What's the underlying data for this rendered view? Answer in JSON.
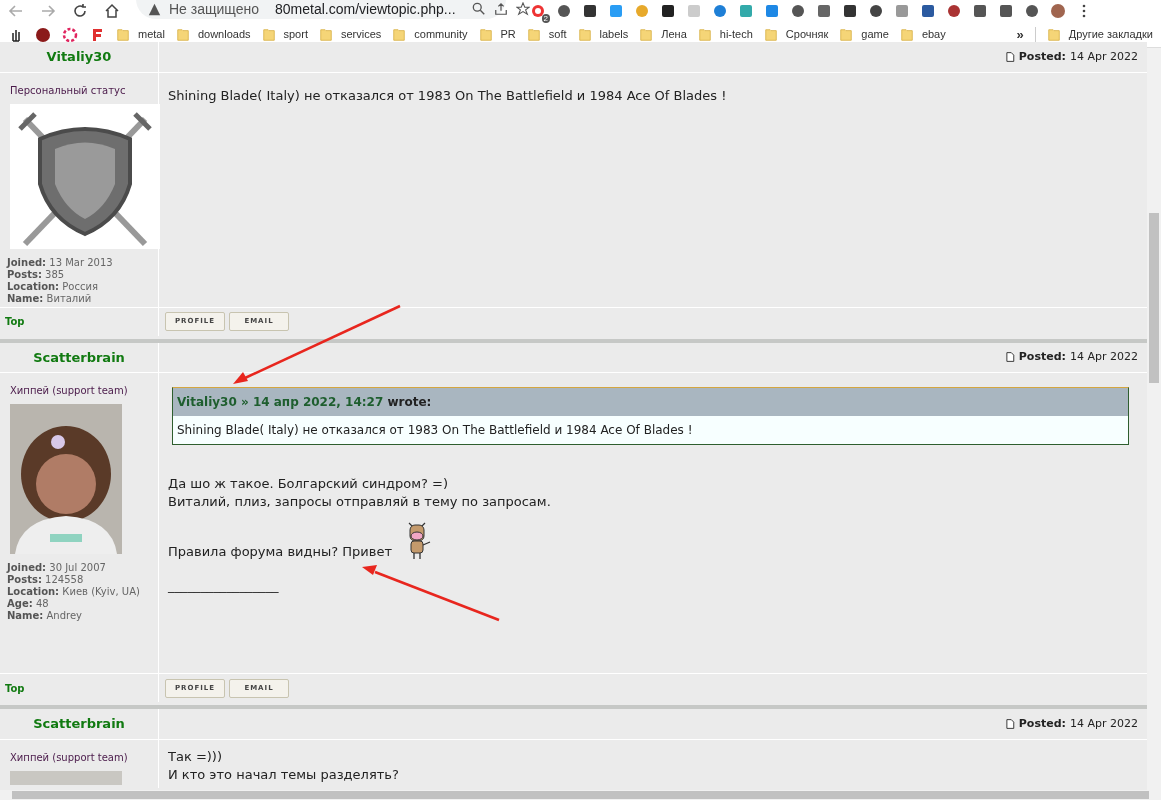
{
  "browser": {
    "security": "Не защищено",
    "url": "80metal.com/viewtopic.php...",
    "extension_badge": "2"
  },
  "bookmarks": {
    "items": [
      "metal",
      "downloads",
      "sport",
      "services",
      "community",
      "PR",
      "soft",
      "labels",
      "Лена",
      "hi-tech",
      "Срочняк",
      "game",
      "ebay"
    ],
    "overflow": "»",
    "other": "Другие закладки"
  },
  "posts": [
    {
      "author": "Vitaliy30",
      "posted_label": "Posted:",
      "date": "14 Apr 2022",
      "rank": "Персональный статус",
      "fields": [
        {
          "label": "Joined:",
          "value": "13 Mar 2013"
        },
        {
          "label": "Posts:",
          "value": "385"
        },
        {
          "label": "Location:",
          "value": "Россия"
        },
        {
          "label": "Name:",
          "value": "Виталий"
        }
      ],
      "body": [
        {
          "kind": "line",
          "text": "Shining Blade( Italy) не отказался от 1983 On The Battlefield и 1984 Ace Of Blades !"
        }
      ],
      "top": "Top",
      "buttons": [
        "PROFILE",
        "EMAIL"
      ]
    },
    {
      "author": "Scatterbrain",
      "posted_label": "Posted:",
      "date": "14 Apr 2022",
      "rank": "Хиппей (support team)",
      "fields": [
        {
          "label": "Joined:",
          "value": "30 Jul 2007"
        },
        {
          "label": "Posts:",
          "value": "124558"
        },
        {
          "label": "Location:",
          "value": "Киев (Kyiv, UA)"
        },
        {
          "label": "Age:",
          "value": "48"
        },
        {
          "label": "Name:",
          "value": "Andrey"
        }
      ],
      "quote": {
        "source": "Vitaliy30 » 14 апр 2022, 14:27",
        "wrote": "wrote:",
        "text": "Shining Blade( Italy) не отказался от 1983 On The Battlefield и 1984 Ace Of Blades !"
      },
      "body": [
        {
          "kind": "line",
          "text": "Да шо ж такое. Болгарский синдром? =)"
        },
        {
          "kind": "line",
          "text": "Виталий, плиз, запросы отправляй в тему по запросам."
        },
        {
          "kind": "emoticon-line",
          "text": "Правила форума видны? Привет"
        },
        {
          "kind": "signature",
          "text": "_________________"
        }
      ],
      "top": "Top",
      "buttons": [
        "PROFILE",
        "EMAIL"
      ]
    },
    {
      "author": "Scatterbrain",
      "posted_label": "Posted:",
      "date": "14 Apr 2022",
      "rank": "Хиппей (support team)",
      "body": [
        {
          "kind": "line",
          "text": "Так =)))"
        },
        {
          "kind": "line",
          "text": "И кто это начал темы разделять?"
        }
      ]
    }
  ]
}
